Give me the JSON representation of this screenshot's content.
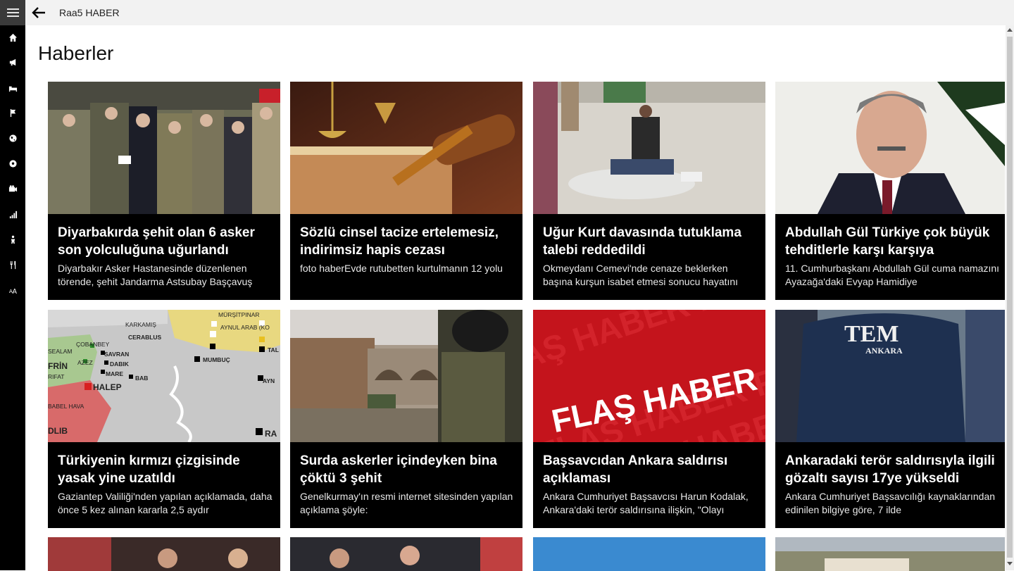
{
  "app": {
    "title": "Raa5 HABER"
  },
  "page_title": "Haberler",
  "nav_icons": [
    "home-icon",
    "megaphone-icon",
    "bed-icon",
    "flag-icon",
    "globe-icon",
    "soccer-ball-icon",
    "camera-icon",
    "signal-bars-icon",
    "person-icon",
    "dining-icon",
    "font-size-icon"
  ],
  "articles": [
    {
      "headline": "Diyarbakırda şehit olan 6 asker son yolculuğuna uğurlandı",
      "summary": "Diyarbakır Asker Hastanesinde düzenlenen törende, şehit Jandarma Astsubay Başçavuş"
    },
    {
      "headline": "Sözlü cinsel tacize ertelemesiz, indirimsiz hapis cezası",
      "summary": "foto haberEvde rutubetten kurtulmanın 12 yolu"
    },
    {
      "headline": "Uğur Kurt davasında tutuklama talebi reddedildi",
      "summary": "Okmeydanı Cemevi'nde cenaze beklerken başına kurşun isabet etmesi sonucu hayatını"
    },
    {
      "headline": "Abdullah Gül Türkiye çok büyük tehditlerle karşı karşıya",
      "summary": "11. Cumhurbaşkanı Abdullah Gül cuma namazını Ayazağa'daki Evyap Hamidiye"
    },
    {
      "headline": "Türkiyenin kırmızı çizgisinde yasak yine uzatıldı",
      "summary": "Gaziantep Valiliği'nden yapılan açıklamada, daha önce 5 kez alınan kararla 2,5 aydır"
    },
    {
      "headline": "Surda askerler içindeyken bina çöktü 3 şehit",
      "summary": "Genelkurmay'ın resmi internet sitesinden yapılan açıklama şöyle:"
    },
    {
      "headline": "Başsavcıdan Ankara saldırısı açıklaması",
      "summary": "Ankara Cumhuriyet Başsavcısı Harun Kodalak, Ankara'daki terör saldırısına ilişkin, \"Olayı"
    },
    {
      "headline": "Ankaradaki terör saldırısıyla ilgili gözaltı sayısı 17ye yükseldi",
      "summary": "Ankara Cumhuriyet Başsavcılığı kaynaklarından edinilen bilgiye göre, 7 ilde"
    }
  ],
  "map_labels": {
    "l1": "MÜRŞİTPINAR",
    "l2": "KARKAMIŞ",
    "l3": "AYNUL ARAB (KO",
    "l4": "CERABLUS",
    "l5": "TAL",
    "l6": "ÇOBANBEY",
    "l7": "SEALAM",
    "l8": "SAVRAN",
    "l9": "AZEZ",
    "l10": "DABIK",
    "l11": "MUMBUÇ",
    "l12": "FRİN",
    "l13": "RIFAT",
    "l14": "MARE",
    "l15": "BAB",
    "l16": "HALEP",
    "l17": "AYN",
    "l18": "BABEL HAVA",
    "l19": "DLIB",
    "l20": "RA"
  },
  "image_texts": {
    "flash": "FLAŞ HABER",
    "bg_flash": "FLAŞ HABER FLAŞ",
    "tem": "TEM",
    "tem_city": "ANKARA"
  },
  "colors": {
    "rail": "#000000",
    "topbar": "#f2f2f2",
    "tile": "#000000",
    "flash_red": "#c4141c"
  }
}
